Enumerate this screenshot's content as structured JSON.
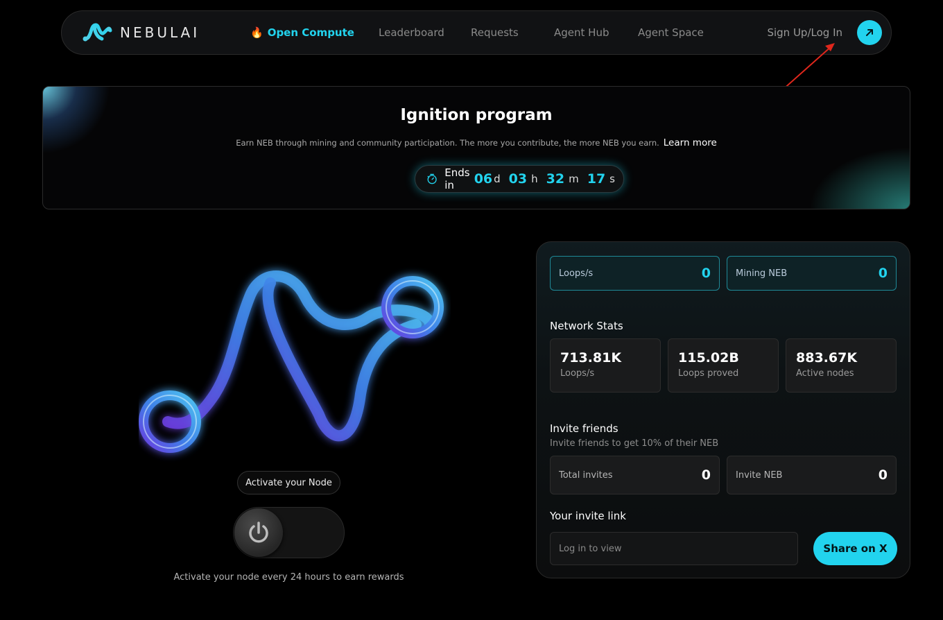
{
  "nav": {
    "logo_text": "NEBULAI",
    "links": [
      {
        "label": "Open Compute",
        "active": true,
        "icon": "fire-icon"
      },
      {
        "label": "Leaderboard"
      },
      {
        "label": "Requests"
      },
      {
        "label": "Agent Hub"
      },
      {
        "label": "Agent Space"
      }
    ],
    "signup_label": "Sign Up/Log In"
  },
  "banner": {
    "title": "Ignition program",
    "subtitle": "Earn NEB through mining and community participation. The more you contribute, the more NEB you earn.",
    "learn_more": "Learn more",
    "countdown": {
      "label": "Ends in",
      "days": "06",
      "days_unit": "d",
      "hours": "03",
      "hours_unit": "h",
      "minutes": "32",
      "minutes_unit": "m",
      "seconds": "17",
      "seconds_unit": "s"
    }
  },
  "node": {
    "activate_label": "Activate your Node",
    "note": "Activate your node every 24 hours to earn rewards"
  },
  "panel": {
    "loops": {
      "label": "Loops/s",
      "value": "0"
    },
    "mining": {
      "label": "Mining NEB",
      "value": "0"
    },
    "network_title": "Network Stats",
    "network": [
      {
        "value": "713.81K",
        "label": "Loops/s"
      },
      {
        "value": "115.02B",
        "label": "Loops proved"
      },
      {
        "value": "883.67K",
        "label": "Active nodes"
      }
    ],
    "invite_title": "Invite friends",
    "invite_sub": "Invite friends to get 10% of their NEB",
    "total_invites": {
      "label": "Total invites",
      "value": "0"
    },
    "invite_neb": {
      "label": "Invite NEB",
      "value": "0"
    },
    "link_title": "Your invite link",
    "link_placeholder": "Log in to view",
    "share_label": "Share on X"
  },
  "colors": {
    "accent": "#22d3ee",
    "background": "#000000"
  }
}
